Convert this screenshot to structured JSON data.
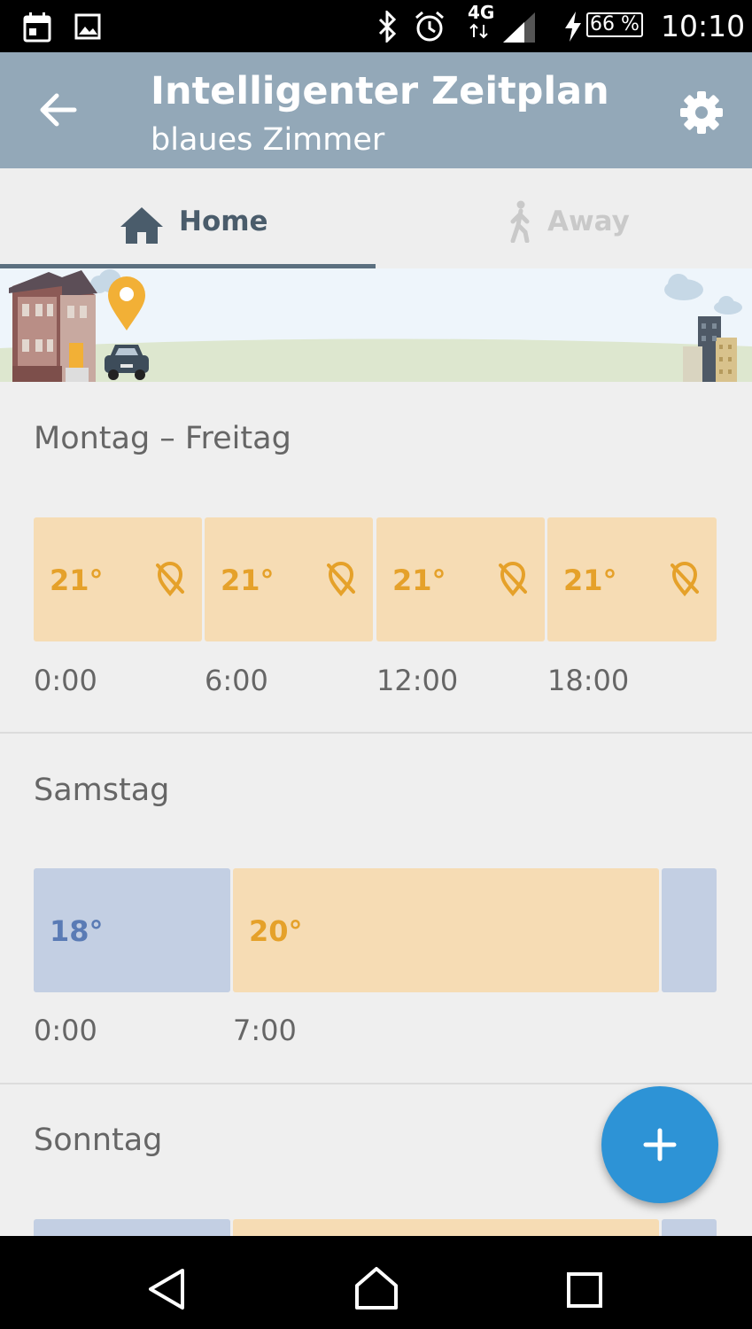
{
  "status_bar": {
    "time": "10:10",
    "battery": "66 %",
    "network": "4G",
    "icons": [
      "calendar-icon",
      "image-icon",
      "bluetooth-icon",
      "alarm-icon",
      "network-4g-icon",
      "signal-icon",
      "charging-icon",
      "battery-icon"
    ]
  },
  "app_bar": {
    "title": "Intelligenter Zeitplan",
    "subtitle": "blaues Zimmer",
    "back_icon": "arrow-back-icon",
    "settings_icon": "gear-icon"
  },
  "tabs": [
    {
      "label": "Home",
      "icon": "home-icon",
      "active": true
    },
    {
      "label": "Away",
      "icon": "walking-person-icon",
      "active": false
    }
  ],
  "schedule": [
    {
      "title": "Montag – Freitag",
      "blocks": [
        {
          "temp": "21°",
          "type": "warm",
          "icon": "location-off-icon"
        },
        {
          "temp": "21°",
          "type": "warm",
          "icon": "location-off-icon"
        },
        {
          "temp": "21°",
          "type": "warm",
          "icon": "location-off-icon"
        },
        {
          "temp": "21°",
          "type": "warm",
          "icon": "location-off-icon"
        }
      ],
      "times": [
        "0:00",
        "6:00",
        "12:00",
        "18:00"
      ]
    },
    {
      "title": "Samstag",
      "blocks": [
        {
          "temp": "18°",
          "type": "cool"
        },
        {
          "temp": "20°",
          "type": "warm"
        },
        {
          "temp": "",
          "type": "cool"
        }
      ],
      "times": [
        "0:00",
        "7:00"
      ]
    },
    {
      "title": "Sonntag"
    }
  ],
  "fab": {
    "icon": "plus-icon"
  },
  "nav_bar": {
    "icons": [
      "back-triangle-icon",
      "home-nav-icon",
      "recents-square-icon"
    ]
  },
  "colors": {
    "app_bar": "#93a8b8",
    "warm_block": "#f6dcb4",
    "warm_text": "#e5a12a",
    "cool_block": "#c3cfe3",
    "cool_text": "#5a7bb5",
    "fab": "#2d93d6"
  }
}
